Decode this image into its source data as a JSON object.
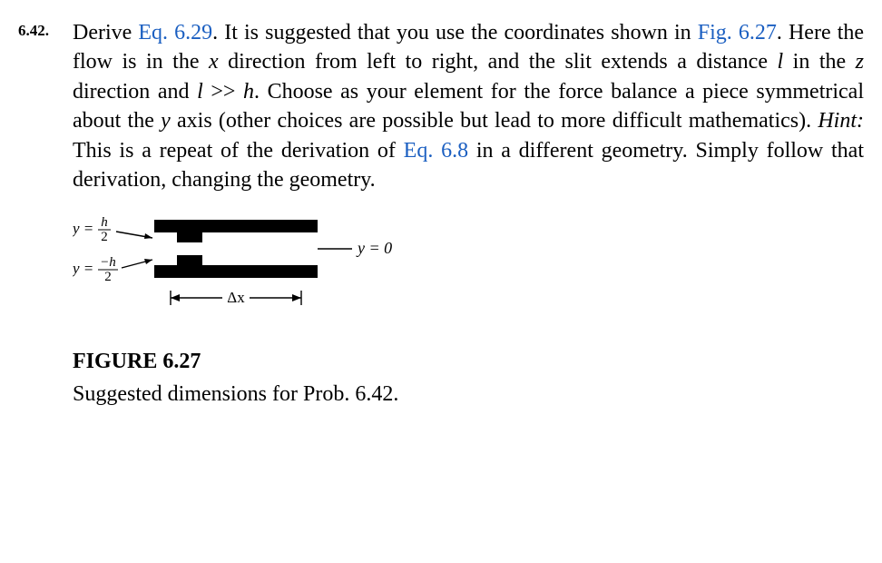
{
  "problem": {
    "number": "6.42.",
    "text_pre_eq": "Derive ",
    "eq_ref": "Eq. 6.29",
    "text_after_eq": ". It is suggested that you use the coordinates shown in ",
    "fig_ref": "Fig. 6.27",
    "text_mid1": ". Here the flow is in the ",
    "var_x": "x",
    "text_mid2": " direction from left to right, and the slit extends a distance ",
    "var_l1": "l",
    "text_mid3": " in the ",
    "var_z": "z",
    "text_mid4": " direction and ",
    "var_l2": "l",
    "text_mid5": " >> ",
    "var_h": "h",
    "text_mid6": ". Choose as your element for the force balance a piece symmetrical about the ",
    "var_y": "y",
    "text_mid7": " axis (other choices are possible but lead to more difficult mathematics). ",
    "hint_label": "Hint:",
    "text_hint1": " This is a repeat of the derivation of ",
    "eq_ref2": "Eq. 6.8",
    "text_hint2": " in a different geometry. Simply follow that derivation, changing the geometry."
  },
  "figure": {
    "label_y_top_lhs": "y =",
    "label_y_top_num": "h",
    "label_y_top_den": "2",
    "label_y_bot_lhs": "y =",
    "label_y_bot_num": "−h",
    "label_y_bot_den": "2",
    "label_y_mid": "y = 0",
    "label_dx": "Δx",
    "caption_title": "FIGURE 6.27",
    "caption_body": "Suggested dimensions for Prob. 6.42."
  }
}
